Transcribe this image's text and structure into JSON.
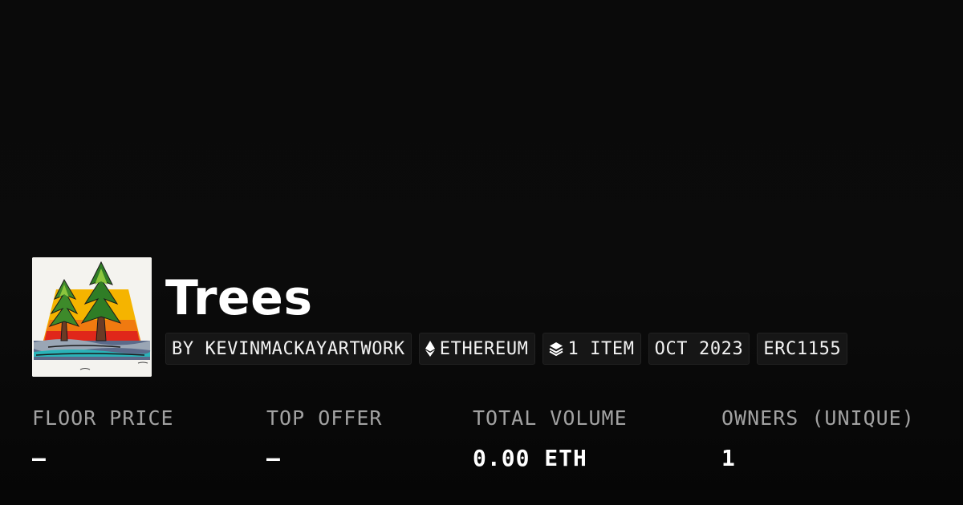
{
  "collection": {
    "title": "Trees",
    "thumbnail_icon": "trees-artwork-thumbnail"
  },
  "tags": {
    "creator": "BY KEVINMACKAYARTWORK",
    "chain": "ETHEREUM",
    "chain_icon": "ethereum-icon",
    "items": "1 ITEM",
    "items_icon": "layers-icon",
    "date": "OCT 2023",
    "standard": "ERC1155"
  },
  "stats": {
    "floor_price": {
      "label": "FLOOR PRICE",
      "value": "–"
    },
    "top_offer": {
      "label": "TOP OFFER",
      "value": "–"
    },
    "total_volume": {
      "label": "TOTAL VOLUME",
      "value": "0.00 ETH"
    },
    "owners": {
      "label": "OWNERS (UNIQUE)",
      "value": "1"
    }
  },
  "colors": {
    "background": "#0b0b0b",
    "tag_background": "#161616",
    "label": "#a2a2a2",
    "text": "#ffffff"
  }
}
